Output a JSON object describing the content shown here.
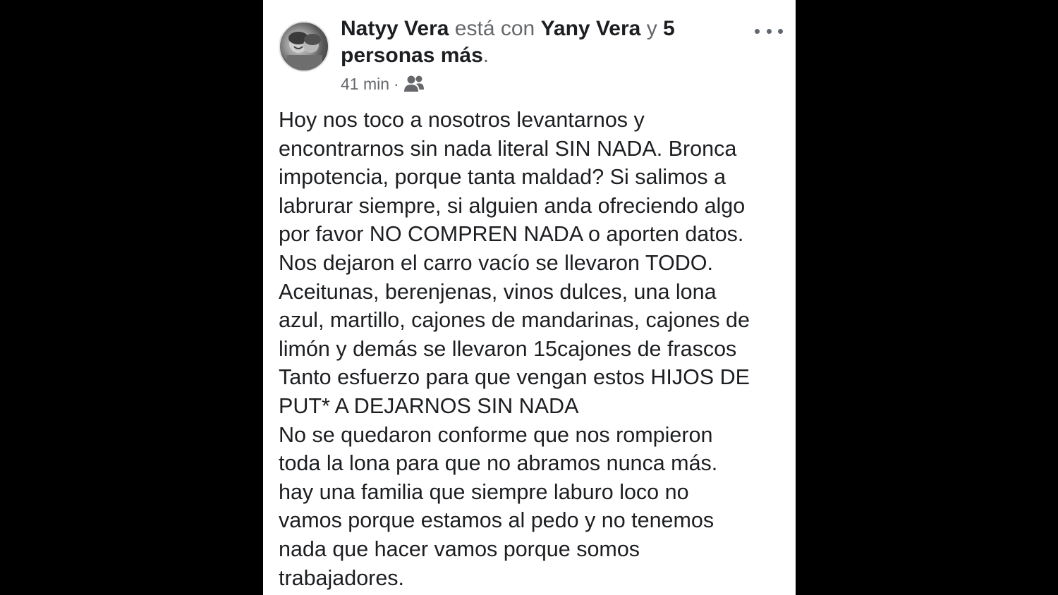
{
  "post": {
    "author": "Natyy Vera",
    "connector_1": "está con",
    "tagged_friend": "Yany Vera",
    "connector_2": "y",
    "others_part_1": "5",
    "others_part_2": "personas más",
    "trailing_period": ".",
    "time": "41 min",
    "separator": "·",
    "audience_icon": "friends-icon",
    "more_icon": "more-options-icon",
    "lines": [
      "Hoy nos toco a nosotros levantarnos y",
      "encontrarnos sin nada literal SIN NADA. Bronca",
      "impotencia, porque tanta maldad? Si salimos a",
      "labrurar siempre, si alguien anda ofreciendo algo",
      "por favor NO COMPREN NADA o aporten datos.",
      "Nos dejaron el carro vacío se llevaron TODO.",
      "Aceitunas, berenjenas, vinos dulces, una lona",
      "azul, martillo, cajones de mandarinas, cajones de",
      "limón y demás se llevaron 15cajones de frascos",
      "Tanto esfuerzo para que vengan estos HIJOS DE",
      "PUT* A DEJARNOS SIN NADA",
      "No se quedaron conforme que nos rompieron",
      "toda la lona para que no abramos nunca más.",
      "hay una familia que siempre laburo loco no",
      "vamos porque estamos al pedo y no tenemos",
      "nada que hacer vamos porque somos",
      "trabajadores."
    ]
  },
  "colors": {
    "background": "#000000",
    "card": "#ffffff",
    "text": "#1c1e21",
    "secondary_text": "#65676b"
  }
}
